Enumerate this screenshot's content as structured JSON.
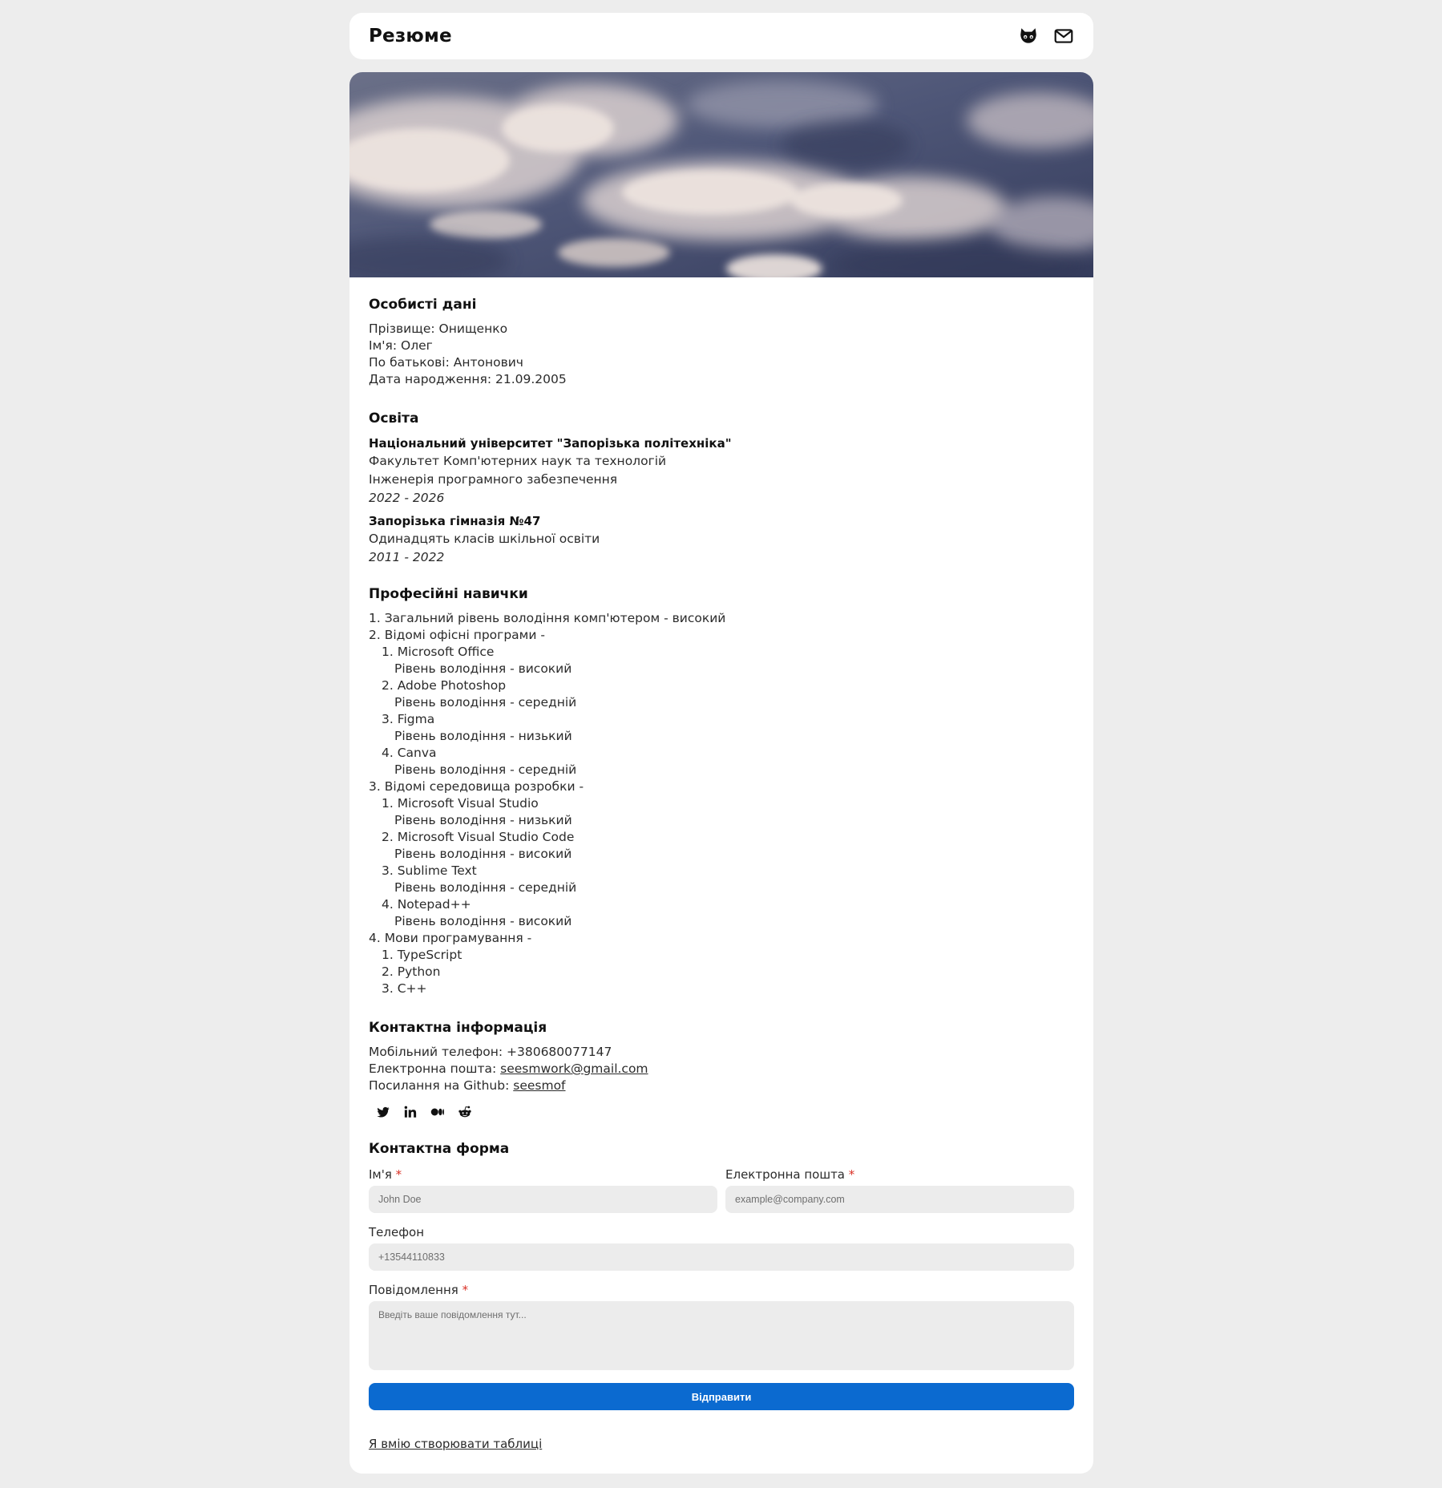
{
  "header": {
    "title": "Резюме",
    "icons": [
      "github-icon",
      "mail-icon"
    ]
  },
  "personal": {
    "title": "Особисті дані",
    "lines": [
      "Прізвище: Онищенко",
      "Ім'я: Олег",
      "По батькові: Антонович",
      "Дата народження: 21.09.2005"
    ]
  },
  "education": {
    "title": "Освіта",
    "items": [
      {
        "name": "Національний університет \"Запорізька політехніка\"",
        "lines": [
          "Факультет Комп'ютерних наук та технологій",
          "Інженерія програмного забезпечення"
        ],
        "years": "2022 - 2026"
      },
      {
        "name": "Запорізька гімназія №47",
        "lines": [
          "Одинадцять класів шкільної освіти"
        ],
        "years": "2011 - 2022"
      }
    ]
  },
  "skills": {
    "title": "Професійні навички",
    "s1": "1. Загальний рівень володіння комп'ютером - високий",
    "s2": "2. Відомі офісні програми -",
    "office": [
      {
        "name": "1. Microsoft Office",
        "level": "Рівень володіння - високий"
      },
      {
        "name": "2. Adobe Photoshop",
        "level": "Рівень володіння - середній"
      },
      {
        "name": "3. Figma",
        "level": "Рівень володіння - низький"
      },
      {
        "name": "4. Canva",
        "level": "Рівень володіння - середній"
      }
    ],
    "s3": "3. Відомі середовища розробки -",
    "ide": [
      {
        "name": "1. Microsoft Visual Studio",
        "level": "Рівень володіння - низький"
      },
      {
        "name": "2. Microsoft Visual Studio Code",
        "level": "Рівень володіння - високий"
      },
      {
        "name": "3. Sublime Text",
        "level": "Рівень володіння - середній"
      },
      {
        "name": "4. Notepad++",
        "level": "Рівень володіння - високий"
      }
    ],
    "s4": "4. Мови програмування -",
    "langs": [
      "1. TypeScript",
      "2. Python",
      "3. C++"
    ]
  },
  "contact": {
    "title": "Контактна інформація",
    "phone": "Мобільний телефон: +380680077147",
    "email_label": "Електронна пошта: ",
    "email": "seesmwork@gmail.com",
    "github_label": "Посилання на Github: ",
    "github": "seesmof",
    "socials": [
      "twitter-icon",
      "linkedin-icon",
      "medium-icon",
      "reddit-icon"
    ]
  },
  "form": {
    "title": "Контактна форма",
    "name_label": "Ім'я",
    "name_placeholder": "John Doe",
    "email_label": "Електронна пошта",
    "email_placeholder": "example@company.com",
    "phone_label": "Телефон",
    "phone_placeholder": "+13544110833",
    "message_label": "Повідомлення",
    "message_placeholder": "Введіть ваше повідомлення тут...",
    "required_mark": "*",
    "submit": "Відправити"
  },
  "footer_link": "Я вмію створювати таблиці",
  "colors": {
    "background": "#ededed",
    "accent": "#0b6ad0",
    "required": "#d93025",
    "input_bg": "#ececec"
  }
}
